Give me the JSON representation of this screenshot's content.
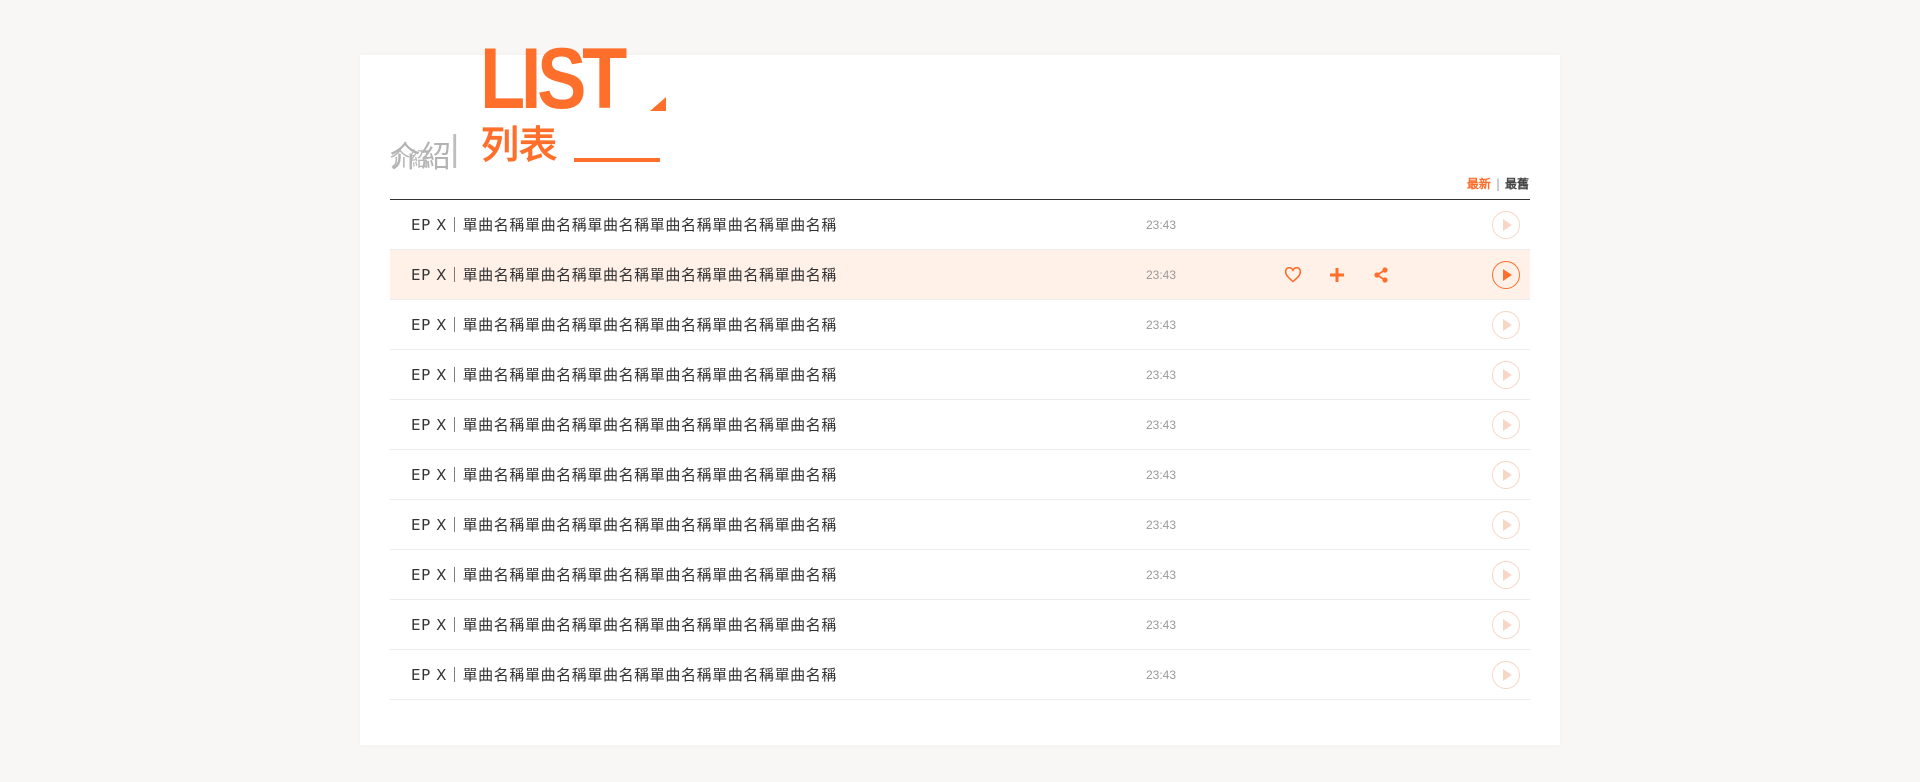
{
  "header": {
    "tab_intro_label": "介紹",
    "tab_intro_shadow": "介紹",
    "tab_separator": "|",
    "banner_word": "LIST",
    "tab_list_label": "列表"
  },
  "sort": {
    "newest_label": "最新",
    "separator": "|",
    "oldest_label": "最舊",
    "active": "newest"
  },
  "colors": {
    "accent": "#ff6f2c",
    "highlight_row": "#fff0e8"
  },
  "icons": {
    "favorite": "heart-icon",
    "add": "plus-icon",
    "share": "share-icon",
    "play": "play-icon"
  },
  "episodes": [
    {
      "title": "EP X｜單曲名稱單曲名稱單曲名稱單曲名稱單曲名稱單曲名稱",
      "duration": "23:43",
      "highlighted": false
    },
    {
      "title": "EP X｜單曲名稱單曲名稱單曲名稱單曲名稱單曲名稱單曲名稱",
      "duration": "23:43",
      "highlighted": true
    },
    {
      "title": "EP X｜單曲名稱單曲名稱單曲名稱單曲名稱單曲名稱單曲名稱",
      "duration": "23:43",
      "highlighted": false
    },
    {
      "title": "EP X｜單曲名稱單曲名稱單曲名稱單曲名稱單曲名稱單曲名稱",
      "duration": "23:43",
      "highlighted": false
    },
    {
      "title": "EP X｜單曲名稱單曲名稱單曲名稱單曲名稱單曲名稱單曲名稱",
      "duration": "23:43",
      "highlighted": false
    },
    {
      "title": "EP X｜單曲名稱單曲名稱單曲名稱單曲名稱單曲名稱單曲名稱",
      "duration": "23:43",
      "highlighted": false
    },
    {
      "title": "EP X｜單曲名稱單曲名稱單曲名稱單曲名稱單曲名稱單曲名稱",
      "duration": "23:43",
      "highlighted": false
    },
    {
      "title": "EP X｜單曲名稱單曲名稱單曲名稱單曲名稱單曲名稱單曲名稱",
      "duration": "23:43",
      "highlighted": false
    },
    {
      "title": "EP X｜單曲名稱單曲名稱單曲名稱單曲名稱單曲名稱單曲名稱",
      "duration": "23:43",
      "highlighted": false
    },
    {
      "title": "EP X｜單曲名稱單曲名稱單曲名稱單曲名稱單曲名稱單曲名稱",
      "duration": "23:43",
      "highlighted": false
    }
  ]
}
